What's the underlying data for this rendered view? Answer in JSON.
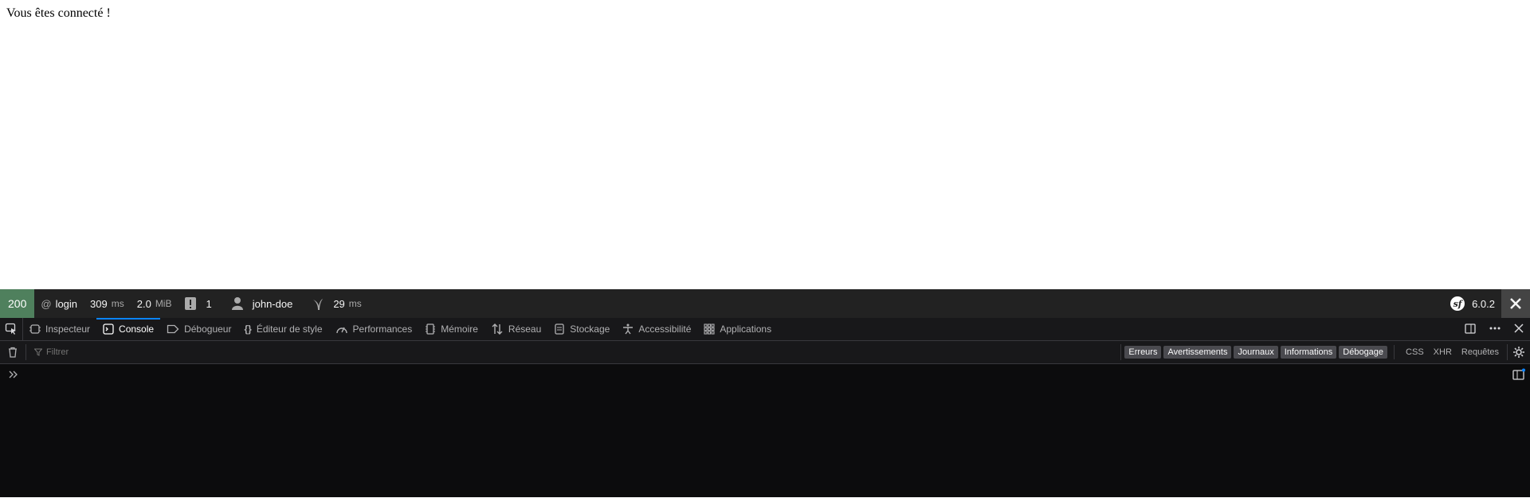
{
  "page": {
    "message": "Vous êtes connecté !"
  },
  "toolbar": {
    "status": "200",
    "route": "login",
    "time_value": "309",
    "time_unit": "ms",
    "memory_value": "2.0",
    "memory_unit": "MiB",
    "logs_count": "1",
    "user": "john-doe",
    "twig_value": "29",
    "twig_unit": "ms",
    "version": "6.0.2",
    "colors": {
      "background": "#222222",
      "status_ok": "#4f805d"
    }
  },
  "devtools": {
    "tabs": [
      {
        "label": "Inspecteur",
        "icon": "inspector-icon"
      },
      {
        "label": "Console",
        "icon": "console-icon",
        "active": true
      },
      {
        "label": "Débogueur",
        "icon": "debugger-icon"
      },
      {
        "label": "Éditeur de style",
        "icon": "style-editor-icon"
      },
      {
        "label": "Performances",
        "icon": "performance-icon"
      },
      {
        "label": "Mémoire",
        "icon": "memory-icon"
      },
      {
        "label": "Réseau",
        "icon": "network-icon"
      },
      {
        "label": "Stockage",
        "icon": "storage-icon"
      },
      {
        "label": "Accessibilité",
        "icon": "accessibility-icon"
      },
      {
        "label": "Applications",
        "icon": "applications-icon"
      }
    ],
    "filter": {
      "placeholder": "Filtrer",
      "levels": [
        "Erreurs",
        "Avertissements",
        "Journaux",
        "Informations",
        "Débogage"
      ],
      "types": [
        "CSS",
        "XHR",
        "Requêtes"
      ]
    },
    "colors": {
      "accent": "#0a84ff",
      "background": "#0c0c0d"
    }
  }
}
